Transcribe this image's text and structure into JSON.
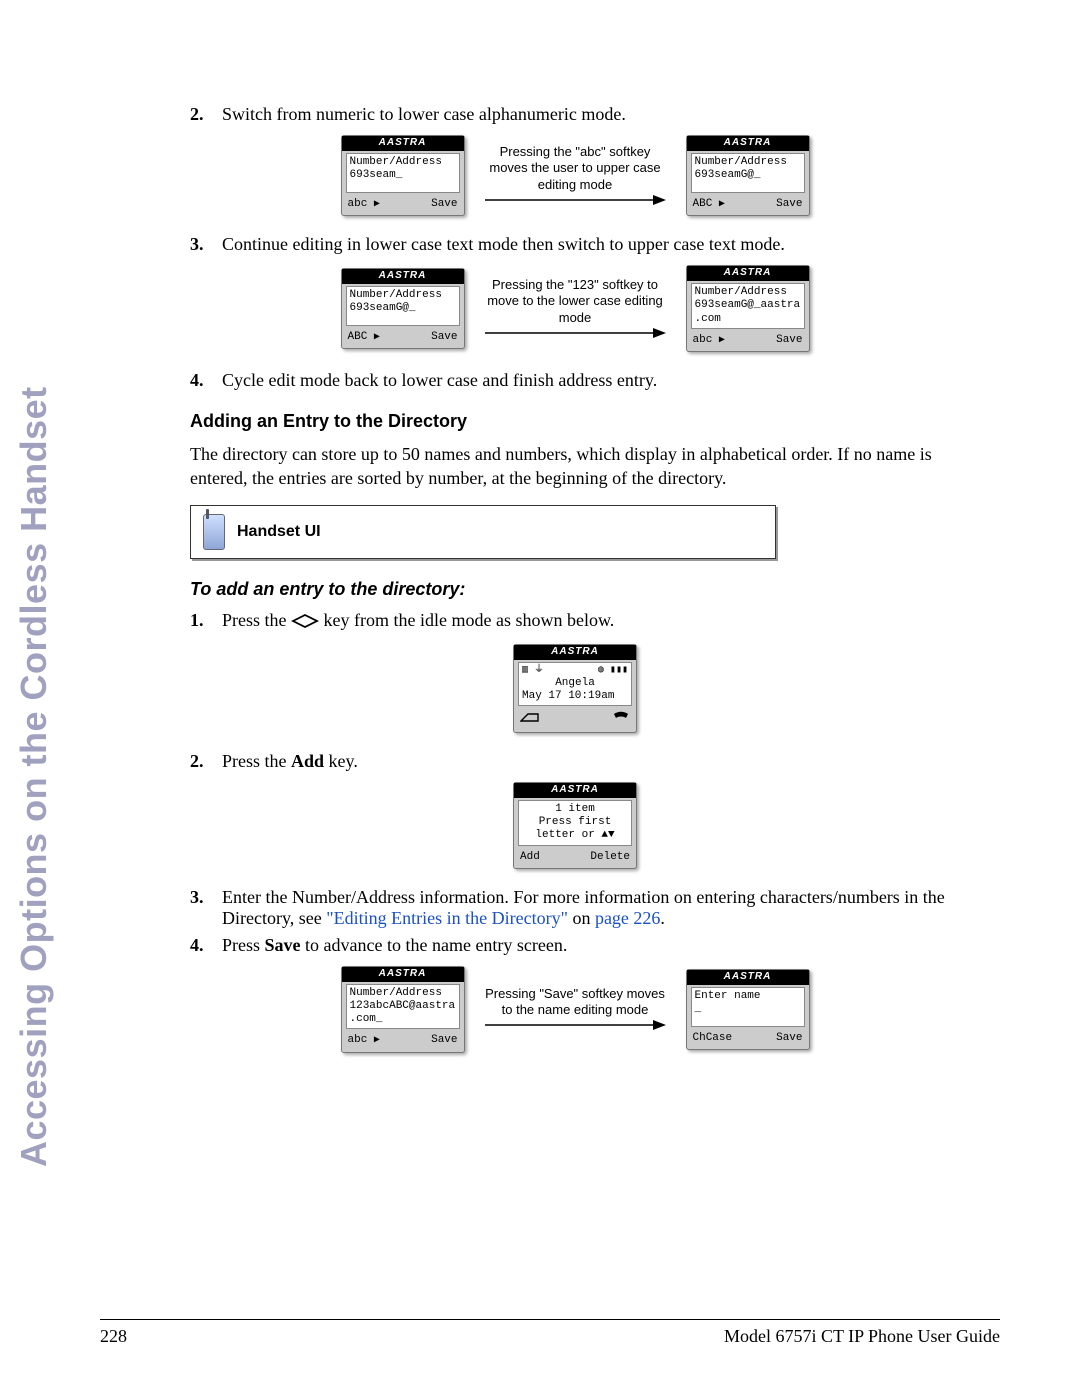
{
  "side_title": "Accessing Options on the Cordless Handset",
  "steps_a": {
    "2": {
      "num": "2.",
      "text": "Switch from numeric to lower case alphanumeric mode.",
      "caption": "Pressing the \"abc\" softkey moves the user to upper case editing  mode",
      "left": {
        "brand": "AASTRA",
        "l1": "Number/Address",
        "l2": "693seam_",
        "sk_left": "abc",
        "sk_right": "Save",
        "arrow": "▶"
      },
      "right": {
        "brand": "AASTRA",
        "l1": "Number/Address",
        "l2": "693seamG@_",
        "sk_left": "ABC",
        "sk_right": "Save",
        "arrow": "▶"
      }
    },
    "3": {
      "num": "3.",
      "text": "Continue editing in lower case text mode then switch to upper case text mode.",
      "caption": "Pressing the \"123\" softkey to move to the lower case editing mode",
      "left": {
        "brand": "AASTRA",
        "l1": "Number/Address",
        "l2": "693seamG@_",
        "sk_left": "ABC",
        "sk_right": "Save",
        "arrow": "▶"
      },
      "right": {
        "brand": "AASTRA",
        "l1": "Number/Address",
        "l2": "693seamG@_aastra",
        "l3": ".com",
        "sk_left": "abc",
        "sk_right": "Save",
        "arrow": "▶"
      }
    },
    "4": {
      "num": "4.",
      "text": "Cycle edit mode back to lower case and finish address entry."
    }
  },
  "heading_add": "Adding an Entry to the Directory",
  "para_add": "The directory can store up to 50 names and numbers, which display in alphabetical order. If no name is entered, the entries are sorted by number, at the beginning of the directory.",
  "callout": {
    "label": "Handset UI"
  },
  "heading_proc": "To add an entry to the directory:",
  "steps_b": {
    "1": {
      "num": "1.",
      "pre": "Press the ",
      "post": " key from the idle mode as shown below.",
      "phone": {
        "brand": "AASTRA",
        "name": "Angela",
        "date": "May 17 10:19am"
      }
    },
    "2": {
      "num": "2.",
      "pre": "Press the ",
      "bold": "Add",
      "post": " key.",
      "phone": {
        "brand": "AASTRA",
        "l1": "1 item",
        "l2": "Press first",
        "l3": "letter or ▲▼",
        "sk_left": "Add",
        "sk_right": "Delete"
      }
    },
    "3": {
      "num": "3.",
      "text": "Enter the Number/Address information. For more information on entering characters/numbers in the Directory, see ",
      "link": "\"Editing Entries in the Directory\"",
      "on": " on ",
      "pagelink": "page 226",
      "end": "."
    },
    "4": {
      "num": "4.",
      "pre": "Press ",
      "bold": "Save",
      "post": " to advance to the name entry screen.",
      "caption": "Pressing \"Save\" softkey moves to the name editing mode",
      "left": {
        "brand": "AASTRA",
        "l1": "Number/Address",
        "l2": "123abcABC@aastra",
        "l3": ".com_",
        "sk_left": "abc",
        "sk_right": "Save",
        "arrow": "▶"
      },
      "right": {
        "brand": "AASTRA",
        "l1": "Enter name",
        "l2": "_",
        "sk_left": "ChCase",
        "sk_right": "Save"
      }
    }
  },
  "footer": {
    "page": "228",
    "guide": "Model 6757i CT IP Phone User Guide"
  }
}
